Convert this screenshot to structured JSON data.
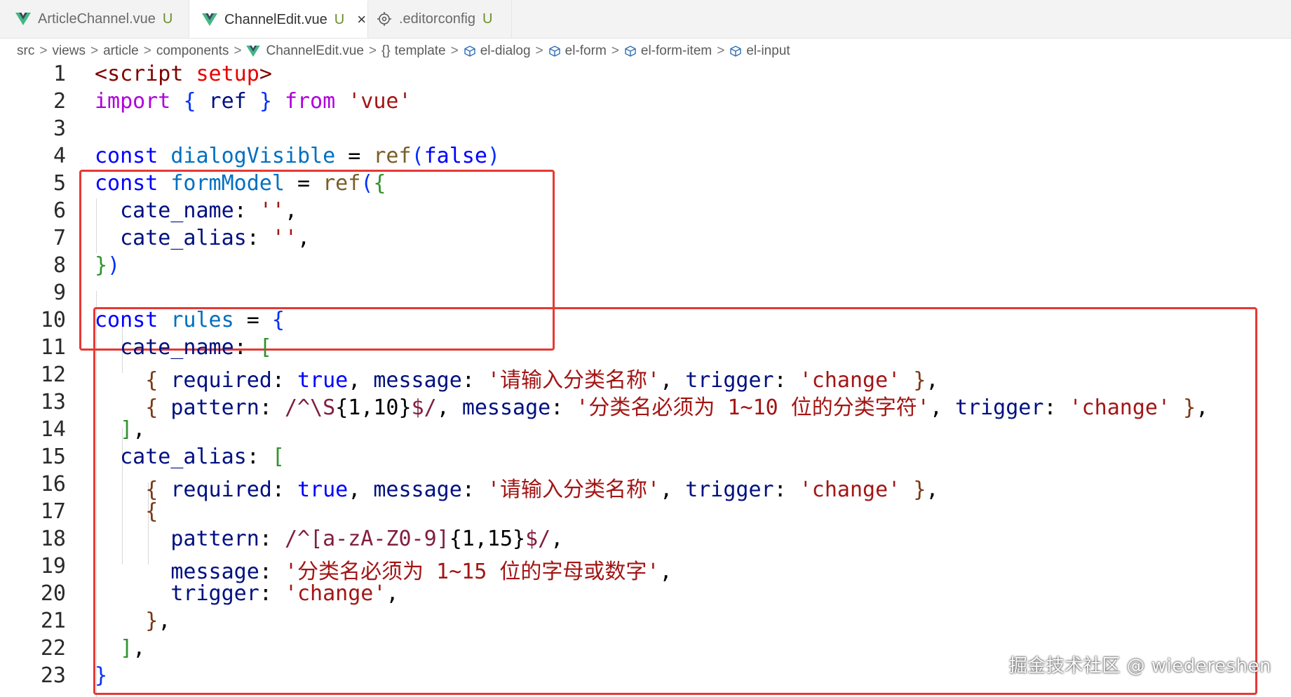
{
  "tabs": [
    {
      "label": "ArticleChannel.vue",
      "status": "U",
      "active": false
    },
    {
      "label": "ChannelEdit.vue",
      "status": "U",
      "active": true,
      "close": "×"
    },
    {
      "label": ".editorconfig",
      "status": "U",
      "active": false
    }
  ],
  "breadcrumb": [
    "src",
    "views",
    "article",
    "components",
    "ChannelEdit.vue",
    "template",
    "el-dialog",
    "el-form",
    "el-form-item",
    "el-input"
  ],
  "breadcrumb_sep": ">",
  "template_icon": "{}",
  "code": [
    {
      "n": "1",
      "t": [
        [
          "<",
          "tag"
        ],
        [
          "script",
          "tag"
        ],
        [
          " ",
          "pun"
        ],
        [
          "setup",
          "attr"
        ],
        [
          ">",
          "tag"
        ]
      ]
    },
    {
      "n": "2",
      "t": [
        [
          "import",
          "ctrl"
        ],
        [
          " ",
          "pun"
        ],
        [
          "{",
          "b1"
        ],
        [
          " ref ",
          "var"
        ],
        [
          "}",
          "b1"
        ],
        [
          " ",
          "pun"
        ],
        [
          "from",
          "ctrl"
        ],
        [
          " ",
          "pun"
        ],
        [
          "'vue'",
          "str"
        ]
      ]
    },
    {
      "n": "3",
      "t": []
    },
    {
      "n": "4",
      "t": [
        [
          "const",
          "kw"
        ],
        [
          " ",
          "pun"
        ],
        [
          "dialogVisible",
          "const"
        ],
        [
          " = ",
          "pun"
        ],
        [
          "ref",
          "fn"
        ],
        [
          "(",
          "b1"
        ],
        [
          "false",
          "bool"
        ],
        [
          ")",
          "b1"
        ]
      ]
    },
    {
      "n": "5",
      "t": [
        [
          "const",
          "kw"
        ],
        [
          " ",
          "pun"
        ],
        [
          "formModel",
          "const"
        ],
        [
          " = ",
          "pun"
        ],
        [
          "ref",
          "fn"
        ],
        [
          "(",
          "b1"
        ],
        [
          "{",
          "b2"
        ]
      ]
    },
    {
      "n": "6",
      "t": [
        [
          "  ",
          "pun"
        ],
        [
          "cate_name",
          "var"
        ],
        [
          ": ",
          "pun"
        ],
        [
          "''",
          "str"
        ],
        [
          ",",
          "pun"
        ]
      ]
    },
    {
      "n": "7",
      "t": [
        [
          "  ",
          "pun"
        ],
        [
          "cate_alias",
          "var"
        ],
        [
          ": ",
          "pun"
        ],
        [
          "''",
          "str"
        ],
        [
          ",",
          "pun"
        ]
      ]
    },
    {
      "n": "8",
      "t": [
        [
          "}",
          "b2"
        ],
        [
          ")",
          "b1"
        ]
      ]
    },
    {
      "n": "9",
      "t": []
    },
    {
      "n": "10",
      "t": [
        [
          "const",
          "kw"
        ],
        [
          " ",
          "pun"
        ],
        [
          "rules",
          "const"
        ],
        [
          " = ",
          "pun"
        ],
        [
          "{",
          "b1"
        ]
      ]
    },
    {
      "n": "11",
      "t": [
        [
          "  ",
          "pun"
        ],
        [
          "cate_name",
          "var"
        ],
        [
          ": ",
          "pun"
        ],
        [
          "[",
          "b2"
        ]
      ]
    },
    {
      "n": "12",
      "t": [
        [
          "    ",
          "pun"
        ],
        [
          "{",
          "b3"
        ],
        [
          " ",
          "pun"
        ],
        [
          "required",
          "var"
        ],
        [
          ": ",
          "pun"
        ],
        [
          "true",
          "bool"
        ],
        [
          ", ",
          "pun"
        ],
        [
          "message",
          "var"
        ],
        [
          ": ",
          "pun"
        ],
        [
          "'请输入分类名称'",
          "str"
        ],
        [
          ", ",
          "pun"
        ],
        [
          "trigger",
          "var"
        ],
        [
          ": ",
          "pun"
        ],
        [
          "'change'",
          "str"
        ],
        [
          " ",
          "pun"
        ],
        [
          "}",
          "b3"
        ],
        [
          ",",
          "pun"
        ]
      ]
    },
    {
      "n": "13",
      "t": [
        [
          "    ",
          "pun"
        ],
        [
          "{",
          "b3"
        ],
        [
          " ",
          "pun"
        ],
        [
          "pattern",
          "var"
        ],
        [
          ": ",
          "pun"
        ],
        [
          "/^\\S",
          "re"
        ],
        [
          "{1,10}",
          "pun"
        ],
        [
          "$/",
          "re"
        ],
        [
          ", ",
          "pun"
        ],
        [
          "message",
          "var"
        ],
        [
          ": ",
          "pun"
        ],
        [
          "'分类名必须为 1~10 位的分类字符'",
          "str"
        ],
        [
          ", ",
          "pun"
        ],
        [
          "trigger",
          "var"
        ],
        [
          ": ",
          "pun"
        ],
        [
          "'change'",
          "str"
        ],
        [
          " ",
          "pun"
        ],
        [
          "}",
          "b3"
        ],
        [
          ",",
          "pun"
        ]
      ]
    },
    {
      "n": "14",
      "t": [
        [
          "  ",
          "pun"
        ],
        [
          "]",
          "b2"
        ],
        [
          ",",
          "pun"
        ]
      ]
    },
    {
      "n": "15",
      "t": [
        [
          "  ",
          "pun"
        ],
        [
          "cate_alias",
          "var"
        ],
        [
          ": ",
          "pun"
        ],
        [
          "[",
          "b2"
        ]
      ]
    },
    {
      "n": "16",
      "t": [
        [
          "    ",
          "pun"
        ],
        [
          "{",
          "b3"
        ],
        [
          " ",
          "pun"
        ],
        [
          "required",
          "var"
        ],
        [
          ": ",
          "pun"
        ],
        [
          "true",
          "bool"
        ],
        [
          ", ",
          "pun"
        ],
        [
          "message",
          "var"
        ],
        [
          ": ",
          "pun"
        ],
        [
          "'请输入分类名称'",
          "str"
        ],
        [
          ", ",
          "pun"
        ],
        [
          "trigger",
          "var"
        ],
        [
          ": ",
          "pun"
        ],
        [
          "'change'",
          "str"
        ],
        [
          " ",
          "pun"
        ],
        [
          "}",
          "b3"
        ],
        [
          ",",
          "pun"
        ]
      ]
    },
    {
      "n": "17",
      "t": [
        [
          "    ",
          "pun"
        ],
        [
          "{",
          "b3"
        ]
      ]
    },
    {
      "n": "18",
      "t": [
        [
          "      ",
          "pun"
        ],
        [
          "pattern",
          "var"
        ],
        [
          ": ",
          "pun"
        ],
        [
          "/^",
          "re"
        ],
        [
          "[a-zA-Z0-9]",
          "re"
        ],
        [
          "{1,15}",
          "pun"
        ],
        [
          "$/",
          "re"
        ],
        [
          ",",
          "pun"
        ]
      ]
    },
    {
      "n": "19",
      "t": [
        [
          "      ",
          "pun"
        ],
        [
          "message",
          "var"
        ],
        [
          ": ",
          "pun"
        ],
        [
          "'分类名必须为 1~15 位的字母或数字'",
          "str"
        ],
        [
          ",",
          "pun"
        ]
      ]
    },
    {
      "n": "20",
      "t": [
        [
          "      ",
          "pun"
        ],
        [
          "trigger",
          "var"
        ],
        [
          ": ",
          "pun"
        ],
        [
          "'change'",
          "str"
        ],
        [
          ",",
          "pun"
        ]
      ]
    },
    {
      "n": "21",
      "t": [
        [
          "    ",
          "pun"
        ],
        [
          "}",
          "b3"
        ],
        [
          ",",
          "pun"
        ]
      ]
    },
    {
      "n": "22",
      "t": [
        [
          "  ",
          "pun"
        ],
        [
          "]",
          "b2"
        ],
        [
          ",",
          "pun"
        ]
      ]
    },
    {
      "n": "23",
      "t": [
        [
          "}",
          "b1"
        ]
      ]
    }
  ],
  "watermark": "掘金技术社区 @ wiedereshen",
  "colors": {
    "highlight_box": "#e53935",
    "vue_green": "#41b883",
    "keyword": "#0000ff",
    "string": "#a31515"
  }
}
